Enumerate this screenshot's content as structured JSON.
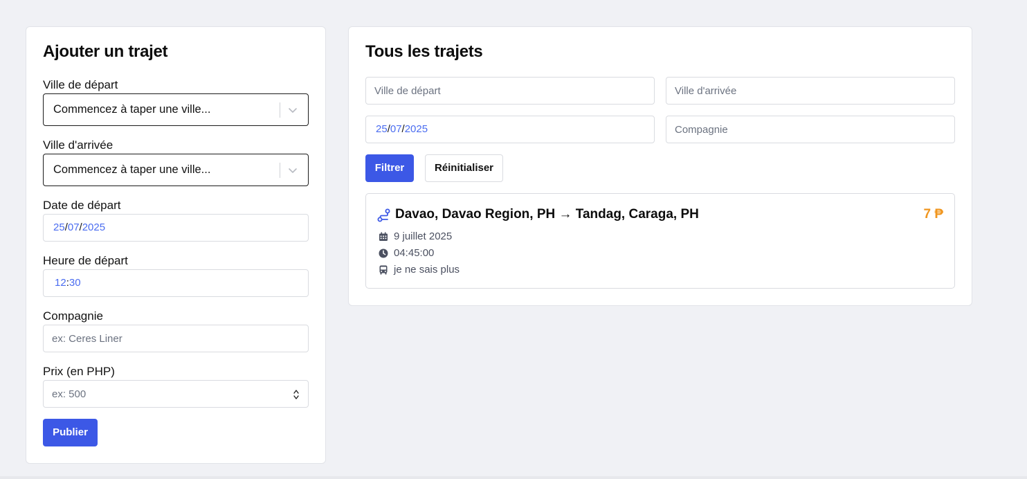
{
  "add_form": {
    "title": "Ajouter un trajet",
    "departure_city_label": "Ville de départ",
    "departure_city_placeholder": "Commencez à taper une ville...",
    "arrival_city_label": "Ville d'arrivée",
    "arrival_city_placeholder": "Commencez à taper une ville...",
    "date_label": "Date de départ",
    "date": {
      "day": "25",
      "month": "07",
      "year": "2025",
      "sep": "/"
    },
    "time_label": "Heure de départ",
    "time": {
      "hours": "12",
      "minutes": "30",
      "sep": ":"
    },
    "company_label": "Compagnie",
    "company_placeholder": "ex: Ceres Liner",
    "price_label": "Prix (en PHP)",
    "price_placeholder": "ex: 500",
    "submit_label": "Publier"
  },
  "list": {
    "title": "Tous les trajets",
    "filter_departure_placeholder": "Ville de départ",
    "filter_arrival_placeholder": "Ville d'arrivée",
    "filter_date": {
      "day": "25",
      "month": "07",
      "year": "2025",
      "sep": "/"
    },
    "filter_company_placeholder": "Compagnie",
    "filter_button": "Filtrer",
    "reset_button": "Réinitialiser",
    "trips": [
      {
        "route": "Davao, Davao Region, PH → Tandag, Caraga, PH",
        "price": "7 ₱",
        "date": "9 juillet 2025",
        "time": "04:45:00",
        "company": "je ne sais plus"
      }
    ]
  },
  "colors": {
    "primary": "#3c58e6",
    "price": "#f0961f",
    "date_segment": "#4a6cf0",
    "background": "#f0f1f5"
  },
  "icons": [
    "chevron-down-icon",
    "route-icon",
    "calendar-icon",
    "clock-icon",
    "bus-icon",
    "spinner-icon"
  ]
}
